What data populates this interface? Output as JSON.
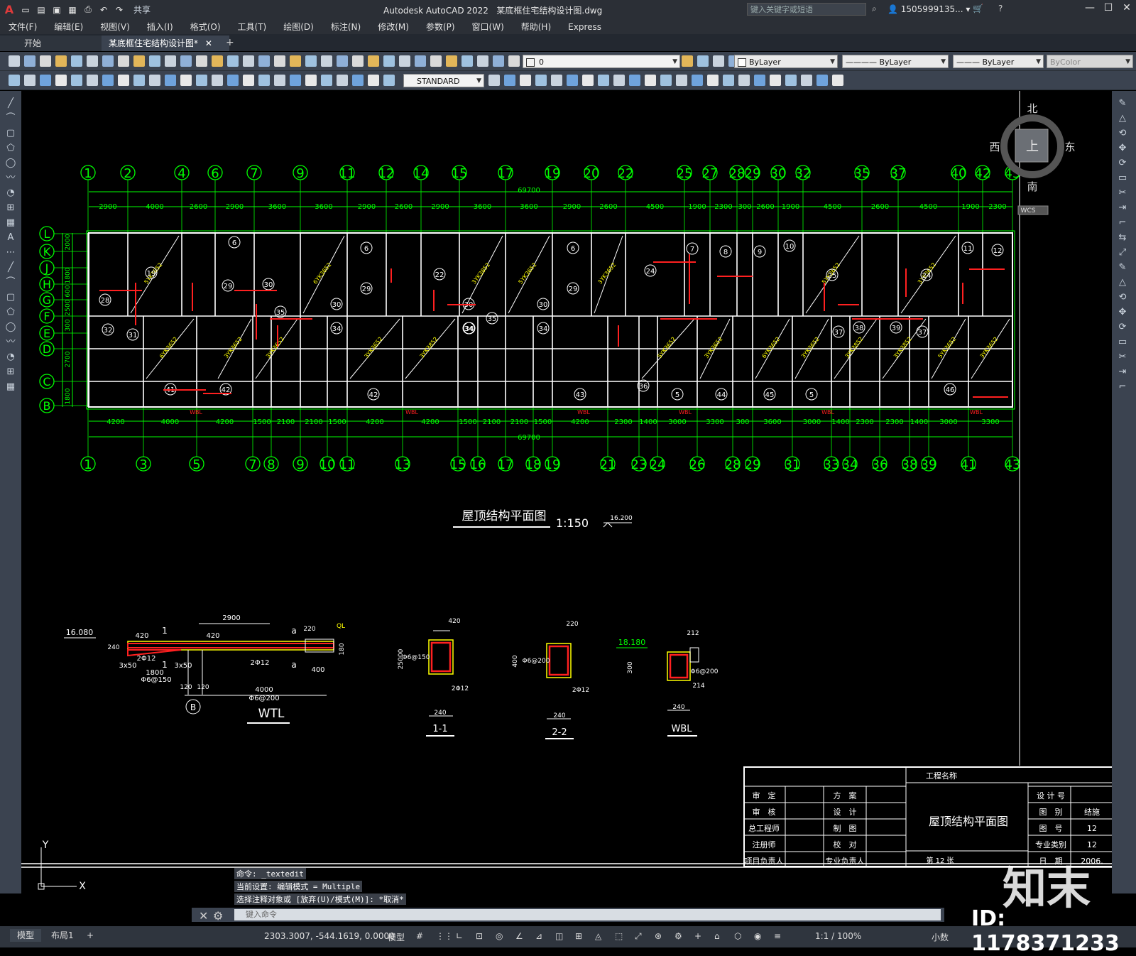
{
  "titlebar": {
    "app_logo": "A",
    "share": "共享",
    "app_name": "Autodesk AutoCAD 2022",
    "file_name": "某底框住宅结构设计图.dwg",
    "search_placeholder": "键入关键字或短语",
    "user": "1505999135..."
  },
  "menu": [
    "文件(F)",
    "编辑(E)",
    "视图(V)",
    "插入(I)",
    "格式(O)",
    "工具(T)",
    "绘图(D)",
    "标注(N)",
    "修改(M)",
    "参数(P)",
    "窗口(W)",
    "帮助(H)",
    "Express"
  ],
  "tabs": {
    "start": "开始",
    "doc": "某底框住宅结构设计图*"
  },
  "layer_toolbar": {
    "layer": "0",
    "color": "ByLayer",
    "linetype": "ByLayer",
    "lineweight": "ByLayer",
    "plotstyle": "ByColor"
  },
  "style_toolbar": {
    "textstyle": "STANDARD"
  },
  "viewcube": {
    "north": "北",
    "south": "南",
    "east": "东",
    "west": "西",
    "top": "上",
    "wcs": "WCS"
  },
  "drawing": {
    "top_axes": [
      "1",
      "2",
      "4",
      "6",
      "7",
      "9",
      "11",
      "12",
      "14",
      "15",
      "17",
      "19",
      "20",
      "22",
      "25",
      "27",
      "28",
      "29",
      "30",
      "32",
      "35",
      "37",
      "40",
      "42",
      "43"
    ],
    "top_total": "69700",
    "top_dims": [
      "2900",
      "4000",
      "2600",
      "2900",
      "3600",
      "3600",
      "2900",
      "2600",
      "2900",
      "3600",
      "3600",
      "2900",
      "2600",
      "4500",
      "1900",
      "2300",
      "300",
      "2600",
      "1900",
      "4500",
      "2600",
      "4500",
      "1900",
      "2300"
    ],
    "bottom_axes": [
      "1",
      "3",
      "5",
      "7",
      "8",
      "9",
      "10",
      "11",
      "13",
      "15",
      "16",
      "17",
      "18",
      "19",
      "21",
      "23",
      "24",
      "26",
      "28",
      "29",
      "31",
      "33",
      "34",
      "36",
      "38",
      "39",
      "41",
      "43"
    ],
    "bottom_total": "69700",
    "bottom_dims": [
      "4200",
      "4000",
      "4200",
      "1500",
      "2100",
      "2100",
      "1500",
      "4200",
      "4200",
      "1500",
      "2100",
      "2100",
      "1500",
      "4200",
      "2300",
      "1400",
      "3000",
      "3300",
      "300",
      "3600",
      "3000",
      "1400",
      "2300",
      "2300",
      "1400",
      "3000",
      "3300"
    ],
    "row_axes": [
      "L",
      "K",
      "J",
      "H",
      "G",
      "F",
      "E",
      "D",
      "C",
      "B"
    ],
    "row_dims": [
      "2000",
      "1800",
      "600",
      "2500",
      "300",
      "2700",
      "1800"
    ],
    "plan_title": "屋顶结构平面图",
    "plan_scale": "1:150",
    "elevation": "16.200",
    "slab_labels": [
      "5YK3652",
      "3YK3652",
      "6YK3652",
      "3YK3652",
      "3YK3852",
      "3YK3852",
      "5YK3652",
      "3YK3652"
    ],
    "beam_labels": [
      "WBL",
      "WBL",
      "WBL",
      "WBL",
      "WBL",
      "WBL"
    ],
    "room_tags": [
      "19",
      "28",
      "32",
      "31",
      "41",
      "6",
      "29",
      "30",
      "35",
      "34",
      "42",
      "6",
      "29",
      "22",
      "30",
      "35",
      "34",
      "42",
      "6",
      "29",
      "30",
      "34",
      "43",
      "24",
      "36",
      "7",
      "8",
      "9",
      "10",
      "25",
      "24",
      "37",
      "38",
      "39",
      "37",
      "11",
      "12",
      "5",
      "44",
      "45",
      "5",
      "46",
      "30",
      "34"
    ],
    "details": {
      "wtl": {
        "title": "WTL",
        "elev": "16.080",
        "dims": [
          "2900",
          "420",
          "420",
          "2Φ12",
          "2Φ12",
          "3x50",
          "1800",
          "Φ6@150",
          "3x50",
          "120",
          "120",
          "4000",
          "Φ6@200",
          "400",
          "220",
          "180",
          "240"
        ],
        "axis": "B",
        "marks": [
          "1",
          "1",
          "a",
          "a",
          "QL"
        ]
      },
      "s11": {
        "title": "1-1",
        "dims": [
          "420",
          "250",
          "400",
          "Φ6@150",
          "2Φ12",
          "240"
        ]
      },
      "s22": {
        "title": "2-2",
        "dims": [
          "220",
          "400",
          "Φ6@200",
          "2Φ12",
          "240"
        ]
      },
      "wbl": {
        "title": "WBL",
        "elev": "18.180",
        "dims": [
          "212",
          "300",
          "Φ6@200",
          "214",
          "240"
        ]
      }
    },
    "titleblock": {
      "project_label": "工程名称",
      "rows_left": [
        "审　定",
        "审　核",
        "总工程师",
        "注册师",
        "项目负责人"
      ],
      "rows_mid": [
        "方　案",
        "设　计",
        "制　图",
        "校　对",
        "专业负责人"
      ],
      "drawing_name": "屋顶结构平面图",
      "sheet": "第 12 张",
      "right_labels": [
        "设 计 号",
        "图　别",
        "图　号",
        "专业类别",
        "日　期"
      ],
      "right_values": [
        "",
        "结施",
        "12",
        "12",
        "2006."
      ]
    },
    "ucs": {
      "x": "X",
      "y": "Y"
    }
  },
  "command": {
    "history": [
      "命令: _textedit",
      "当前设置: 编辑模式 = Multiple",
      "选择注释对象或 [放弃(U)/模式(M)]: *取消*"
    ],
    "placeholder": "键入命令"
  },
  "status": {
    "tabs": [
      "模型",
      "布局1"
    ],
    "add": "+",
    "coords": "2303.3007, -544.1619, 0.0000",
    "space": "模型",
    "scale": "1:1 / 100%",
    "units": "小数"
  },
  "watermark": {
    "brand": "知末",
    "id": "ID: 1178371233"
  },
  "colors": {
    "grid": "#00ff00",
    "wall": "#ffffff",
    "rebar": "#ff2020",
    "label": "#ffff00",
    "slab_label": "#ffff00"
  }
}
